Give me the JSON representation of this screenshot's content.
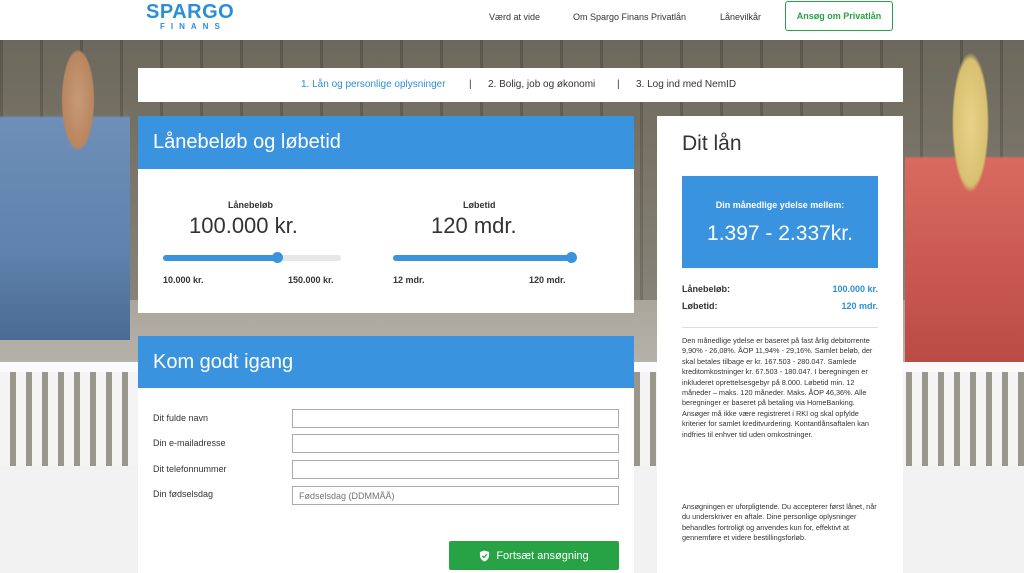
{
  "header": {
    "logo_top": "SPARGO",
    "logo_bottom": "FINANS",
    "nav": [
      "Værd at vide",
      "Om Spargo Finans Privatlån",
      "Lånevilkår"
    ],
    "apply_label": "Ansøg om Privatlån"
  },
  "steps": {
    "items": [
      "1. Lån og personlige oplysninger",
      "2. Bolig, job og økonomi",
      "3. Log ind med NemID"
    ],
    "separator": "|",
    "active_index": 0
  },
  "loan": {
    "title": "Lånebeløb og løbetid",
    "amount": {
      "label": "Lånebeløb",
      "value": "100.000 kr.",
      "min_label": "10.000 kr.",
      "max_label": "150.000 kr.",
      "fraction": 0.643
    },
    "term": {
      "label": "Løbetid",
      "value": "120 mdr.",
      "min_label": "12 mdr.",
      "max_label": "120 mdr.",
      "fraction": 1.0
    }
  },
  "start": {
    "title": "Kom godt igang",
    "fields": [
      {
        "label": "Dit fulde navn",
        "value": "",
        "placeholder": ""
      },
      {
        "label": "Din e-mailadresse",
        "value": "",
        "placeholder": ""
      },
      {
        "label": "Dit telefonnummer",
        "value": "",
        "placeholder": ""
      },
      {
        "label": "Din fødselsdag",
        "value": "",
        "placeholder": "Fødselsdag (DDMMÅÅ)"
      }
    ],
    "continue_label": "Fortsæt ansøgning"
  },
  "summary": {
    "title": "Dit lån",
    "monthly_label": "Din månedlige ydelse mellem:",
    "monthly_range": "1.397 - 2.337kr.",
    "amount_label": "Lånebeløb:",
    "amount_value": "100.000 kr.",
    "term_label": "Løbetid:",
    "term_value": "120 mdr.",
    "fine_print_1": "Den månedlige ydelse er baseret på fast årlig debitorrente 9,90% - 26,08%. ÅOP 11,94% - 29,16%. Samlet beløb, der skal betales tilbage er kr. 167.503 - 280.047. Samlede kreditomkostninger kr. 67.503 - 180.047. I beregningen er inkluderet oprettelsesgebyr på 8.000. Løbetid min. 12 måneder – maks. 120 måneder. Maks. ÅOP 46,36%. Alle beregninger er baseret på betaling via HomeBanking. Ansøger må ikke være registreret i RKI og skal opfylde kriterier for samlet kreditvurdering. Kontantlånsaftalen kan indfries til enhver tid uden omkostninger.",
    "fine_print_2": "Ansøgningen er uforpligtende. Du accepterer først lånet, når du underskriver en aftale. Dine personlige oplysninger behandles fortroligt og anvendes kun for, effektivt at gennemføre et videre bestillingsforløb."
  },
  "colors": {
    "brand_blue": "#3a93de",
    "green": "#27a244"
  }
}
